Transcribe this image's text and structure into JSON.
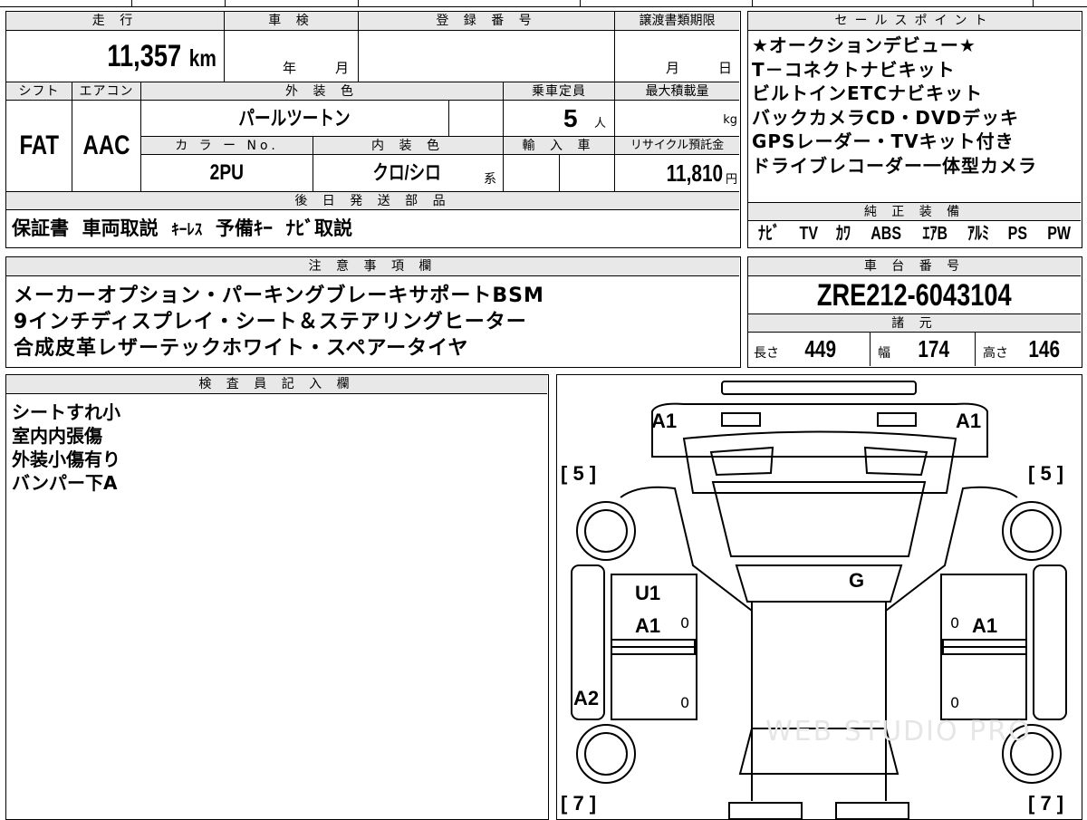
{
  "vehicle": {
    "mileage_label": "走 行",
    "mileage": "11,357",
    "mileage_unit": "km",
    "inspection_label": "車 検",
    "inspection_year": "年",
    "inspection_month": "月",
    "registration_label": "登 録 番 号",
    "transfer_label": "譲渡書類期限",
    "transfer_month": "月",
    "transfer_day": "日",
    "shift_label": "シフト",
    "shift": "FAT",
    "ac_label": "エアコン",
    "ac": "AAC",
    "exterior_label": "外 装 色",
    "exterior": "パールツートン",
    "capacity_label": "乗車定員",
    "capacity": "5",
    "capacity_unit": "人",
    "max_load_label": "最大積載量",
    "max_load_unit": "kg",
    "color_no_label": "カ ラ ー No.",
    "color_no": "2PU",
    "interior_label": "内 装 色",
    "interior": "クロ/シロ",
    "interior_suffix": "系",
    "import_label": "輸 入 車",
    "recycle_label": "リサイクル預託金",
    "recycle_amount": "11,810",
    "recycle_unit": "円"
  },
  "sales_points": {
    "label": "セールスポイント",
    "lines": [
      "★オークションデビュー★",
      "T－コネクトナビキット",
      "ビルトインETCナビキット",
      "バックカメラCD・DVDデッキ",
      "GPSレーダー・TVキット付き",
      "ドライブレコーダー一体型カメラ"
    ]
  },
  "later_parts": {
    "label": "後 日 発 送 部 品",
    "items": [
      "保証書",
      "車両取説",
      "ｷｰﾚｽ",
      "予備ｷｰ",
      "ﾅﾋﾞ取説"
    ]
  },
  "genuine_equipment": {
    "label": "純 正 装 備",
    "items": [
      "ﾅﾋﾞ",
      "TV",
      "ｶﾜ",
      "ABS",
      "ｴｱB",
      "ｱﾙﾐ",
      "PS",
      "PW"
    ]
  },
  "notes": {
    "label": "注 意 事 項 欄",
    "lines": [
      "メーカーオプション・パーキングブレーキサポートBSM",
      "9インチディスプレイ・シート＆ステアリングヒーター",
      "合成皮革レザーテックホワイト・スペアータイヤ"
    ]
  },
  "chassis": {
    "label": "車 台 番 号",
    "number": "ZRE212-6043104"
  },
  "specs": {
    "label": "諸 元",
    "length_label": "長さ",
    "length": "449",
    "width_label": "幅",
    "width": "174",
    "height_label": "高さ",
    "height": "146"
  },
  "inspector": {
    "label": "検 査 員 記 入 欄",
    "lines": [
      "シートすれ小",
      "室内内張傷",
      "外装小傷有り",
      "バンパー下A"
    ]
  },
  "diagram": {
    "marks": {
      "front_left": "A1",
      "front_right": "A1",
      "tire_fl": "[ 5 ]",
      "tire_fr": "[ 5 ]",
      "tire_rl": "[ 7 ]",
      "tire_rr": "[ 7 ]",
      "door_fl_1": "U1",
      "door_fl_2": "A1",
      "door_fr": "A1",
      "roof": "G",
      "rear_left_quarter": "A2",
      "zero_1": "0",
      "zero_2": "0",
      "zero_3": "0",
      "zero_4": "0"
    },
    "watermark": "WEB STUDIO PRO"
  }
}
